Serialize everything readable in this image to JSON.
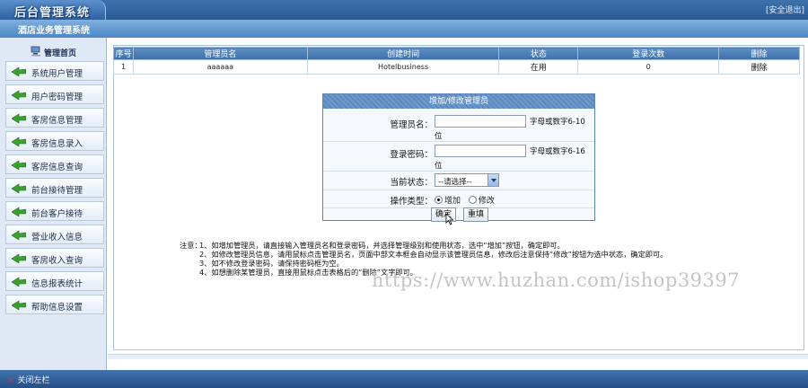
{
  "header": {
    "logo_text": "后台管理系统",
    "logout_label": "[安全退出]",
    "system_title": "酒店业务管理系统"
  },
  "sidebar": {
    "home_label": "管理首页",
    "items": [
      {
        "label": "系统用户管理"
      },
      {
        "label": "用户密码管理"
      },
      {
        "label": "客房信息管理"
      },
      {
        "label": "客房信息录入"
      },
      {
        "label": "客房信息查询"
      },
      {
        "label": "前台接待管理"
      },
      {
        "label": "前台客户接待"
      },
      {
        "label": "营业收入信息"
      },
      {
        "label": "客房收入查询"
      },
      {
        "label": "信息报表统计"
      },
      {
        "label": "帮助信息设置"
      }
    ],
    "collapse_label": "关闭左栏"
  },
  "admin_table": {
    "headers": [
      "序号",
      "管理员名",
      "创建时间",
      "状态",
      "登录次数",
      "删除"
    ],
    "rows": [
      {
        "index": "1",
        "name": "aaaaaa",
        "created": "Hotelbusiness",
        "status": "在用",
        "logins": "0",
        "delete": "删除"
      }
    ]
  },
  "form": {
    "title": "增加/修改管理员",
    "name_label": "管理员名：",
    "name_value": "",
    "name_hint_1": "字母或数字6-10",
    "name_hint_2": "位",
    "password_label": "登录密码：",
    "password_value": "",
    "password_hint_1": "字母或数字6-16",
    "password_hint_2": "位",
    "status_label": "当前状态：",
    "status_selected": "--请选择--",
    "op_label": "操作类型：",
    "op_add": "增加",
    "op_modify": "修改",
    "op_selected": "add",
    "submit_label": "确定",
    "reset_label": "重填"
  },
  "notes": {
    "prefix": "注意：",
    "items": [
      "1、如增加管理员，请直接输入管理员名和登录密码，并选择管理级别和使用状态，选中“增加”按钮，确定即可。",
      "2、如修改管理员信息，请用鼠标点击管理员名，页面中部文本框会自动显示该管理员信息，修改后注意保持“修改”按钮为选中状态，确定即可。",
      "3、如不修改登录密码，请保持密码框为空。",
      "4、如想删除某管理员，直接用鼠标点击表格后的“删除”文字即可。"
    ]
  },
  "watermark": "https://www.huzhan.com/ishop39397",
  "colors": {
    "header_blue": "#2a5a94",
    "title_blue": "#4c86c4",
    "table_header": "#3c6faa",
    "sidebar_bg": "#dfe8f4"
  }
}
